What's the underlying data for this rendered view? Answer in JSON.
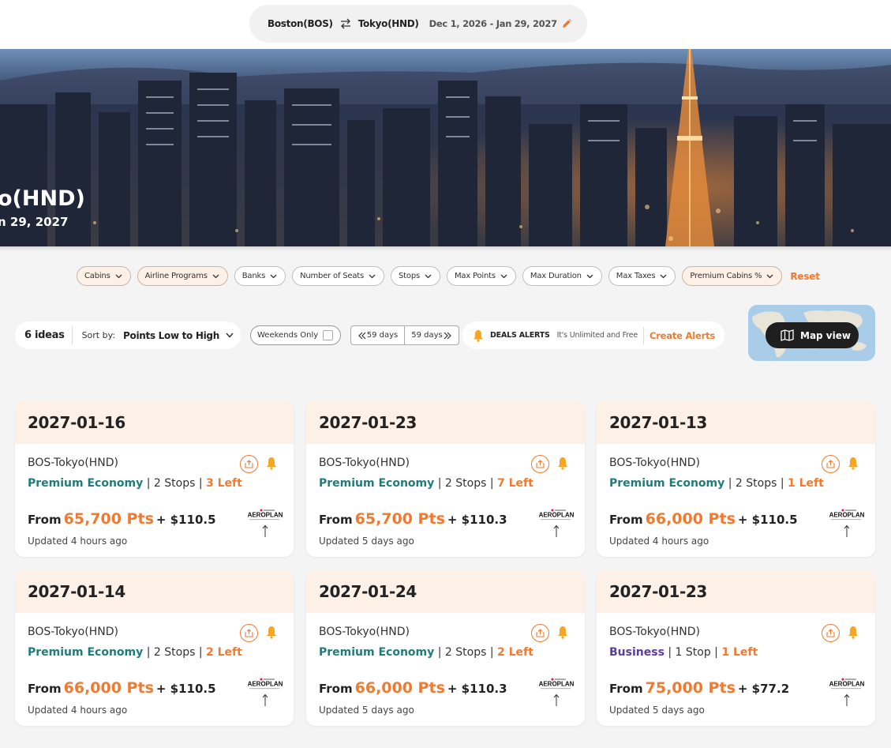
{
  "search": {
    "origin": "Boston(BOS)",
    "destination": "Tokyo(HND)",
    "dates": "Dec 1, 2026 - Jan 29, 2027"
  },
  "hero": {
    "title": "o(HND)",
    "subtitle": "n 29, 2027"
  },
  "filters": {
    "items": [
      {
        "label": "Cabins",
        "active": true
      },
      {
        "label": "Airline Programs",
        "active": true
      },
      {
        "label": "Banks",
        "active": false
      },
      {
        "label": "Number of Seats",
        "active": false
      },
      {
        "label": "Stops",
        "active": false
      },
      {
        "label": "Max Points",
        "active": false
      },
      {
        "label": "Max Duration",
        "active": false
      },
      {
        "label": "Max Taxes",
        "active": false
      },
      {
        "label": "Premium Cabins %",
        "active": true
      }
    ],
    "reset_label": "Reset"
  },
  "toolbar": {
    "ideas_count": "6 ideas",
    "sort_label": "Sort by:",
    "sort_value": "Points Low to High",
    "weekends_label": "Weekends Only",
    "days_prev": "59 days",
    "days_next": "59 days",
    "alerts_title": "DEALS ALERTS",
    "alerts_sub": "It's Unlimited and Free",
    "alerts_link": "Create Alerts",
    "map_label": "Map view"
  },
  "cards": [
    {
      "date": "2027-01-16",
      "route": "BOS-Tokyo(HND)",
      "cabin": "Premium Economy",
      "cabin_type": "prem",
      "stops": "2 Stops",
      "left": "3 Left",
      "from": "From",
      "points": "65,700 Pts",
      "taxes": "+ $110.5",
      "updated": "Updated 4 hours ago",
      "program_logo": "AEROPLAN"
    },
    {
      "date": "2027-01-23",
      "route": "BOS-Tokyo(HND)",
      "cabin": "Premium Economy",
      "cabin_type": "prem",
      "stops": "2 Stops",
      "left": "7 Left",
      "from": "From",
      "points": "65,700 Pts",
      "taxes": "+ $110.3",
      "updated": "Updated 5 days ago",
      "program_logo": "AEROPLAN"
    },
    {
      "date": "2027-01-13",
      "route": "BOS-Tokyo(HND)",
      "cabin": "Premium Economy",
      "cabin_type": "prem",
      "stops": "2 Stops",
      "left": "1 Left",
      "from": "From",
      "points": "66,000 Pts",
      "taxes": "+ $110.5",
      "updated": "Updated 4 hours ago",
      "program_logo": "AEROPLAN"
    },
    {
      "date": "2027-01-14",
      "route": "BOS-Tokyo(HND)",
      "cabin": "Premium Economy",
      "cabin_type": "prem",
      "stops": "2 Stops",
      "left": "2 Left",
      "from": "From",
      "points": "66,000 Pts",
      "taxes": "+ $110.5",
      "updated": "Updated 4 hours ago",
      "program_logo": "AEROPLAN"
    },
    {
      "date": "2027-01-24",
      "route": "BOS-Tokyo(HND)",
      "cabin": "Premium Economy",
      "cabin_type": "prem",
      "stops": "2 Stops",
      "left": "2 Left",
      "from": "From",
      "points": "66,000 Pts",
      "taxes": "+ $110.3",
      "updated": "Updated 5 days ago",
      "program_logo": "AEROPLAN"
    },
    {
      "date": "2027-01-23",
      "route": "BOS-Tokyo(HND)",
      "cabin": "Business",
      "cabin_type": "biz",
      "stops": "1 Stop",
      "left": "1 Left",
      "from": "From",
      "points": "75,000 Pts",
      "taxes": "+ $77.2",
      "updated": "Updated 5 days ago",
      "program_logo": "AEROPLAN"
    }
  ],
  "colors": {
    "accent": "#f07a30",
    "premium_economy": "#1f7c7c",
    "business": "#5c3b9e",
    "card_header": "#fdf1e7"
  }
}
